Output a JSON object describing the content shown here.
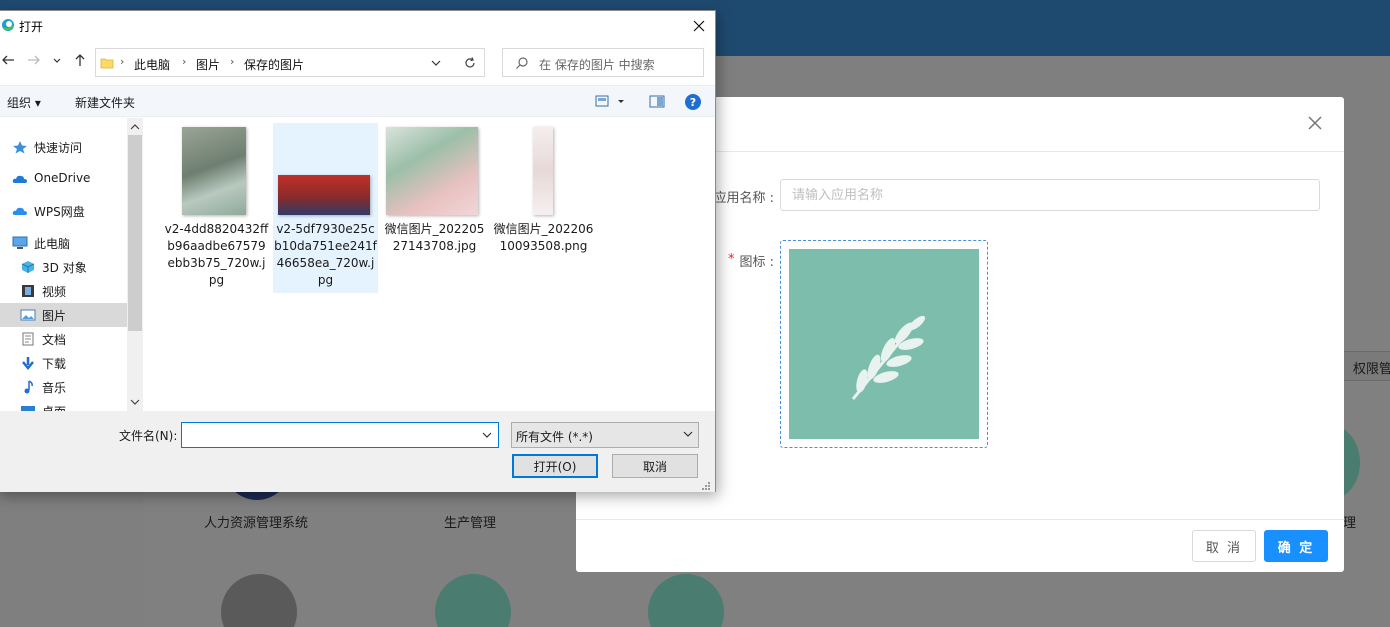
{
  "background": {
    "tab_label": "权限管",
    "apps": [
      {
        "label": "人力资源管理系统"
      },
      {
        "label": "生产管理"
      },
      {
        "label": "理"
      }
    ]
  },
  "modal": {
    "name_label": "应用名称 :",
    "name_placeholder": "请输入应用名称",
    "required_mark": "*",
    "icon_label": "图标 :",
    "cancel_label": "取 消",
    "ok_label": "确 定",
    "accent_color": "#1890ff",
    "icon_tile_color": "#7cbdac",
    "close_icon": "close-icon"
  },
  "dialog": {
    "title": "打开",
    "breadcrumbs": [
      "此电脑",
      "图片",
      "保存的图片"
    ],
    "search_placeholder": "在 保存的图片 中搜索",
    "toolbar": {
      "organize": "组织 ▾",
      "new_folder": "新建文件夹"
    },
    "nav_items": [
      {
        "label": "快速访问",
        "icon": "star-icon"
      },
      {
        "label": "OneDrive",
        "icon": "cloud-icon"
      },
      {
        "label": "WPS网盘",
        "icon": "cloud-icon"
      },
      {
        "label": "此电脑",
        "icon": "computer-icon"
      },
      {
        "label": "3D 对象",
        "icon": "cube-icon"
      },
      {
        "label": "视频",
        "icon": "film-icon"
      },
      {
        "label": "图片",
        "icon": "picture-icon",
        "selected": true
      },
      {
        "label": "文档",
        "icon": "document-icon"
      },
      {
        "label": "下载",
        "icon": "download-icon"
      },
      {
        "label": "音乐",
        "icon": "music-icon"
      },
      {
        "label": "桌面",
        "icon": "desktop-icon"
      }
    ],
    "files": [
      {
        "name": "v2-4dd8820432ffb96aadbe67579ebb3b75_720w.jpg",
        "selected": false
      },
      {
        "name": "v2-5df7930e25cb10da751ee241f46658ea_720w.jpg",
        "selected": true
      },
      {
        "name": "微信图片_20220527143708.jpg",
        "selected": false
      },
      {
        "name": "微信图片_20220610093508.png",
        "selected": false
      }
    ],
    "file_name_label": "文件名(N):",
    "file_name_value": "",
    "file_type": "所有文件 (*.*)",
    "open_label": "打开(O)",
    "cancel_label": "取消"
  }
}
